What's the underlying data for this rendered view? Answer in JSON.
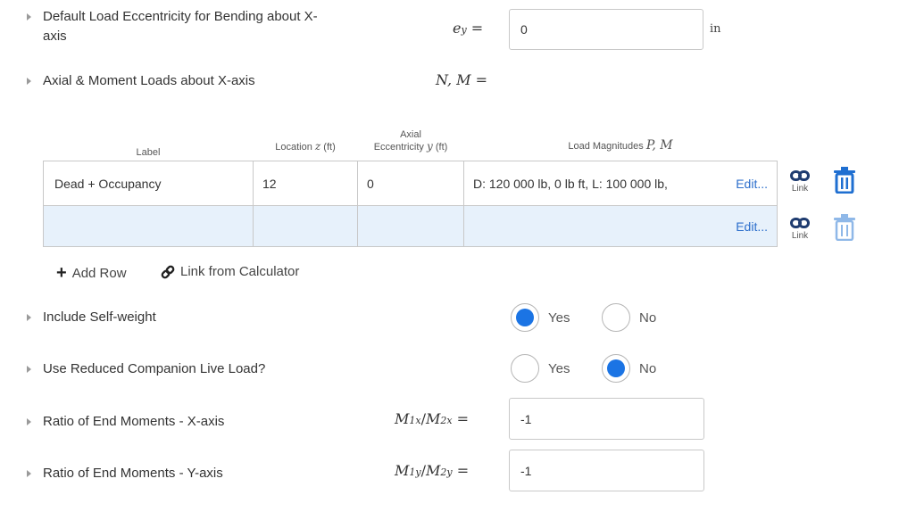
{
  "eccentricity": {
    "label": "Default Load Eccentricity for Bending about X-axis",
    "label_line1": "Default Load Eccentricity for Bending about X-",
    "label_line2": "axis",
    "symbol": "e",
    "symbol_sub": "y",
    "equals": "=",
    "value": "0",
    "unit": "in"
  },
  "axial_loads": {
    "label": "Axial & Moment Loads about X-axis",
    "symbol": "N, M ="
  },
  "table": {
    "headers": {
      "label": "Label",
      "location": "Location",
      "location_sym": "z",
      "location_unit": "(ft)",
      "ecc_line1": "Axial",
      "ecc_line2": "Eccentricity",
      "ecc_sym": "y",
      "ecc_unit": "(ft)",
      "load": "Load Magnitudes",
      "load_sym": "P, M"
    },
    "rows": [
      {
        "label": "Dead + Occupancy",
        "location": "12",
        "eccentricity": "0",
        "loads": "D: 120 000 lb, 0 lb ft, L: 100 000 lb,",
        "edit": "Edit...",
        "link": "Link"
      },
      {
        "label": "",
        "location": "",
        "eccentricity": "",
        "loads": "",
        "edit": "Edit...",
        "link": "Link"
      }
    ],
    "add_row": "Add Row",
    "link_from_calc": "Link from Calculator"
  },
  "self_weight": {
    "label": "Include Self-weight",
    "yes": "Yes",
    "no": "No",
    "selected": "Yes"
  },
  "reduced_live": {
    "label": "Use Reduced Companion Live Load?",
    "yes": "Yes",
    "no": "No",
    "selected": "No"
  },
  "ratio_x": {
    "label": "Ratio of End Moments - X-axis",
    "sym_num": "M",
    "sub_num": "1x",
    "sym_den": "M",
    "sub_den": "2x",
    "value": "-1"
  },
  "ratio_y": {
    "label": "Ratio of End Moments - Y-axis",
    "sym_num": "M",
    "sub_num": "1y",
    "sym_den": "M",
    "sub_den": "2y",
    "value": "-1"
  },
  "colors": {
    "accent": "#1b74e4",
    "link": "#2d6fcc",
    "empty_cell": "#e7f1fb",
    "trash": "#1f6fd1"
  }
}
